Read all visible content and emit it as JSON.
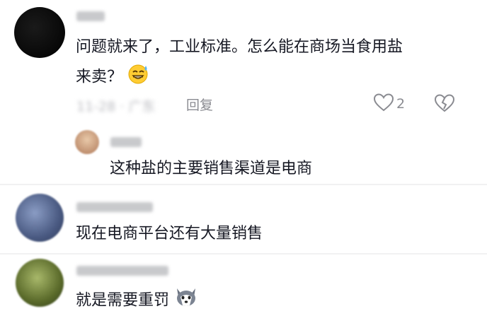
{
  "comments": [
    {
      "username": "",
      "text_line1": "问题就来了，工业标准。怎么能在商场当食用盐",
      "text_line2": "来卖？",
      "emoji": "grinning-sweat-emoji",
      "timestamp": "11-28 · 广东",
      "reply_label": "回复",
      "like_count": "2",
      "replies": [
        {
          "username": "",
          "text": "这种盐的主要销售渠道是电商"
        }
      ]
    },
    {
      "username": "",
      "text": "现在电商平台还有大量销售"
    },
    {
      "username": "",
      "text": "就是需要重罚",
      "emoji": "husky-emoji"
    }
  ],
  "colors": {
    "text": "#161823",
    "meta": "#8a8b91",
    "divider": "#f1f1f2"
  }
}
